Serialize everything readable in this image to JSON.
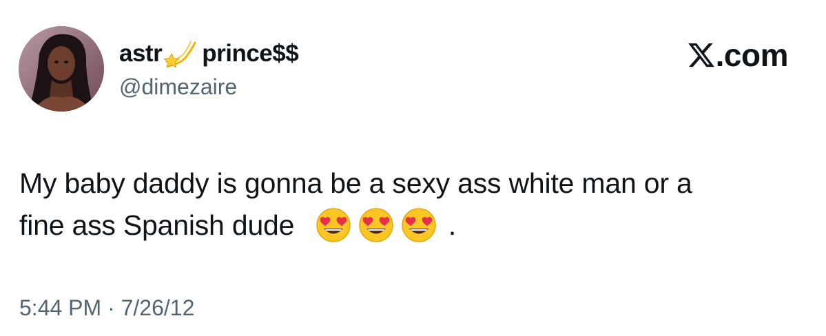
{
  "author": {
    "display_name_before": "astr",
    "display_name_emoji": "shooting-star-icon",
    "display_name_after": "prince$$",
    "handle": "@dimezaire",
    "avatar": "avatar-photo"
  },
  "brand": {
    "logo": "x-logo-icon",
    "suffix": ".com"
  },
  "tweet": {
    "line1": "My baby daddy is gonna be a sexy ass white man or a",
    "line2": "fine ass Spanish dude",
    "emojis": [
      "heart-eyes-emoji",
      "heart-eyes-emoji",
      "heart-eyes-emoji"
    ],
    "end_punctuation": "."
  },
  "meta": {
    "time": "5:44 PM",
    "separator": "·",
    "date": "7/26/12"
  },
  "colors": {
    "text": "#0f1419",
    "secondary": "#536471",
    "background": "#ffffff"
  }
}
